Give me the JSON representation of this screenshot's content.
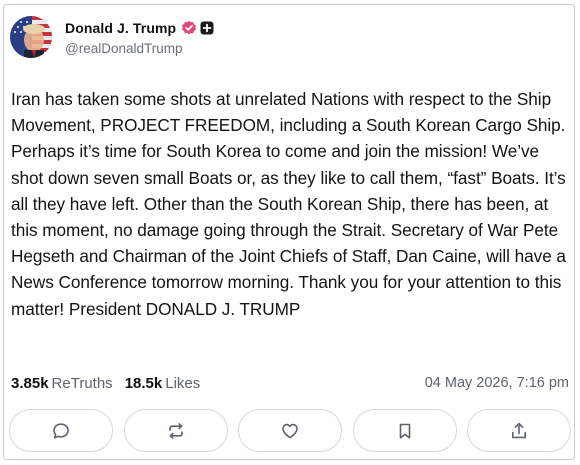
{
  "post": {
    "author": {
      "display_name": "Donald J. Trump",
      "handle": "@realDonaldTrump",
      "verified": true,
      "avatar_icon": "avatar-flag-portrait"
    },
    "body": "Iran has taken some shots at unrelated Nations with respect to the Ship Movement, PROJECT FREEDOM, including a South Korean Cargo Ship. Perhaps it’s time for South Korea to come and join the mission! We’ve shot down seven small Boats or, as they like to call them, “fast” Boats. It’s all they have left. Other than the South Korean Ship, there has been, at this moment, no damage going through the Strait. Secretary of War Pete Hegseth and Chairman of the Joint Chiefs of Staff, Dan Caine, will have a News Conference tomorrow morning. Thank you for your attention to this matter! President DONALD J. TRUMP",
    "stats": {
      "retruths_count": "3.85k",
      "retruths_label": "ReTruths",
      "likes_count": "18.5k",
      "likes_label": "Likes"
    },
    "timestamp": "04 May 2026, 7:16 pm"
  },
  "actions": [
    {
      "name": "reply",
      "icon": "comment-icon"
    },
    {
      "name": "retruth",
      "icon": "repost-icon"
    },
    {
      "name": "like",
      "icon": "heart-icon"
    },
    {
      "name": "bookmark",
      "icon": "bookmark-icon"
    },
    {
      "name": "share",
      "icon": "share-icon"
    }
  ],
  "colors": {
    "verified_badge": "#e0457b",
    "border": "#c9ccd8",
    "muted_text": "#5e6270",
    "icon": "#5e6270"
  }
}
